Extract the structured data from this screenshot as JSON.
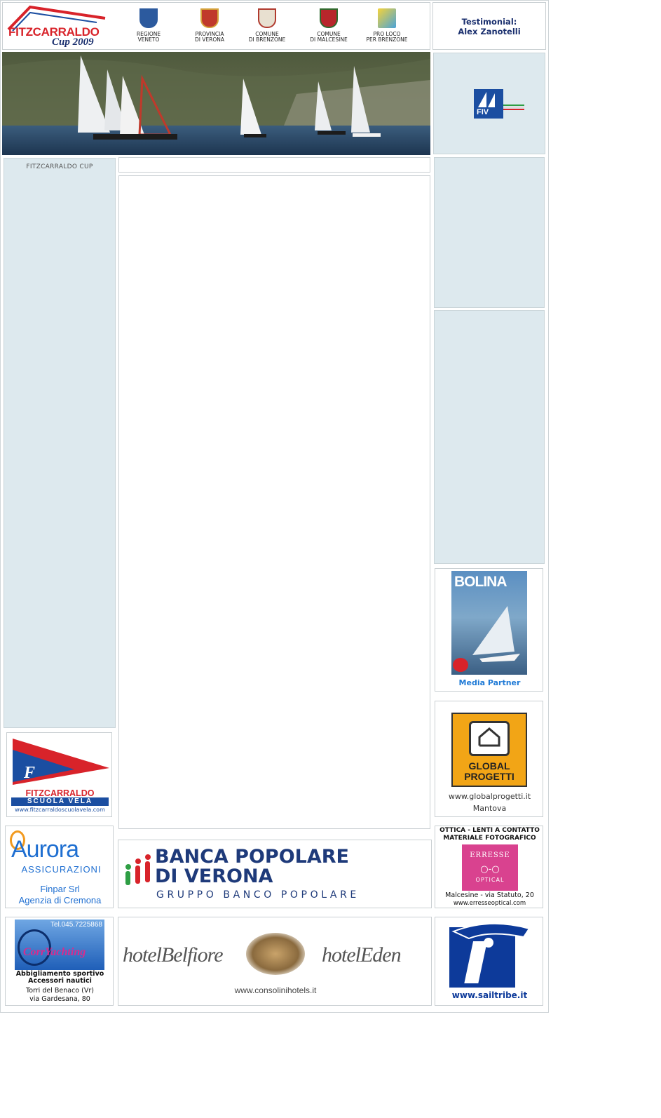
{
  "header": {
    "logo_line1": "FITZCARRALDO",
    "logo_line2": "Cup 2009",
    "municipalities": [
      {
        "line1": "REGIONE",
        "line2": "VENETO"
      },
      {
        "line1": "PROVINCIA",
        "line2": "DI VERONA"
      },
      {
        "line1": "COMUNE",
        "line2": "DI BRENZONE"
      },
      {
        "line1": "COMUNE",
        "line2": "DI MALCESINE"
      },
      {
        "line1": "PRO LOCO",
        "line2": "PER BRENZONE"
      }
    ],
    "testimonial_label": "Testimonial:",
    "testimonial_name": "Alex Zanotelli"
  },
  "fiv": {
    "text": "FIV"
  },
  "left_sidebar": {
    "title": "FITZCARRALDO CUP"
  },
  "ads": {
    "scuola_vela": {
      "line1": "FITZCARRALDO",
      "line2": "SCUOLA VELA",
      "url": "www.fitzcarraldoscuolavela.com"
    },
    "bolina": {
      "title": "BOLINA",
      "caption": "Media Partner"
    },
    "global_progetti": {
      "line1": "GLOBAL",
      "line2": "PROGETTI",
      "url": "www.globalprogetti.it",
      "city": "Mantova"
    },
    "aurora": {
      "name": "Aurora",
      "sub": "ASSICURAZIONI",
      "line1": "Finpar Srl",
      "line2": "Agenzia di Cremona"
    },
    "banca": {
      "line1": "BANCA POPOLARE",
      "line2": "DI VERONA",
      "line3": "GRUPPO BANCO POPOLARE"
    },
    "ottica": {
      "line1": "OTTICA - LENTI A CONTATTO",
      "line2": "MATERIALE FOTOGRAFICO",
      "brand": "ERRESSE",
      "brand_sub": "OPTICAL",
      "address": "Malcesine - via Statuto, 20",
      "url": "www.erresseoptical.com"
    },
    "corr": {
      "phone": "Tel.045.7225868",
      "brand": "CorrYachting",
      "line1": "Abbigliamento sportivo",
      "line2": "Accessori nautici",
      "line3": "Torri  del  Benaco (Vr)",
      "line4": "via Gardesana, 80"
    },
    "hotels": {
      "left": "hotelBelfiore",
      "right": "hotelEden",
      "url": "www.consolinihotels.it"
    },
    "sailtribe": {
      "url": "www.sailtribe.it"
    }
  },
  "colors": {
    "accent": "#1b4ea1",
    "panel": "#dde9ee",
    "red": "#d8232a",
    "navy": "#1a2f6e"
  }
}
